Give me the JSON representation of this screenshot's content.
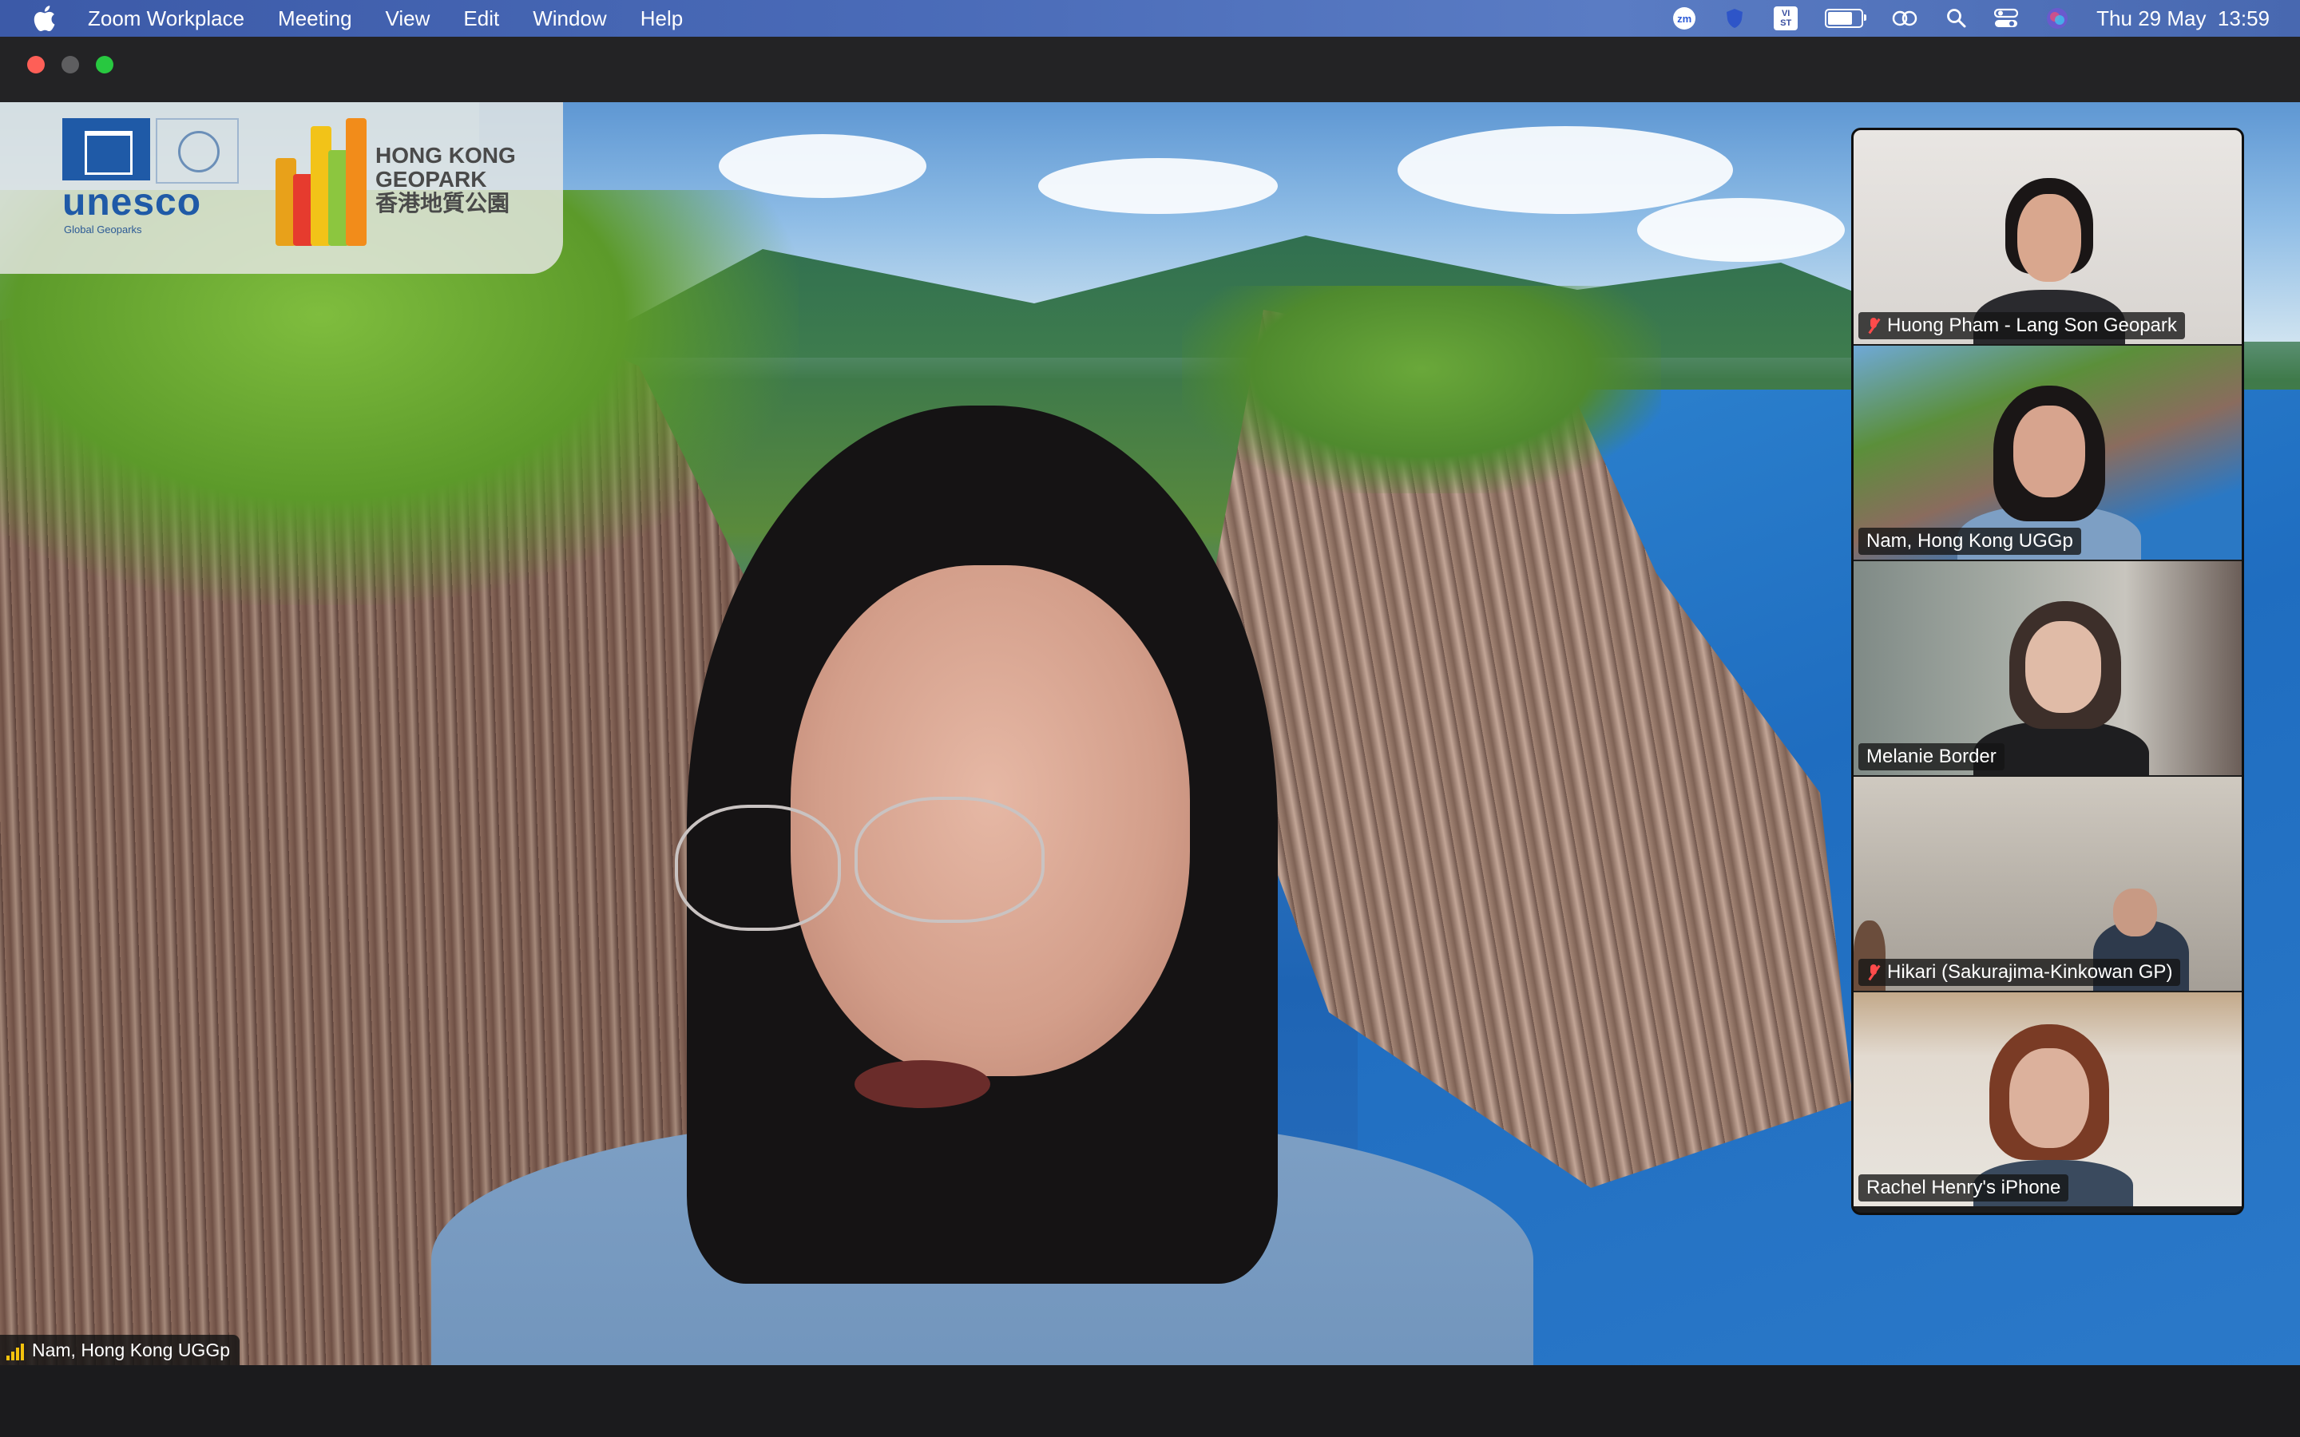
{
  "menubar": {
    "app_name": "Zoom Workplace",
    "items": [
      "Meeting",
      "View",
      "Edit",
      "Window",
      "Help"
    ],
    "status": {
      "zoom_badge": "zm",
      "vist_badge_top": "VI",
      "vist_badge_bottom": "ST",
      "date": "Thu 29 May",
      "time": "13:59",
      "battery_level": 0.75
    }
  },
  "main_video": {
    "speaker_label": "Nam, Hong Kong UGGp",
    "logos": {
      "unesco_text": "unesco",
      "unesco_sub": "Global Geoparks",
      "geopark_line1": "HONG KONG",
      "geopark_line2": "GEOPARK",
      "geopark_line3": "香港地質公園"
    }
  },
  "participants": [
    {
      "name": "Huong Pham - Lang Son Geopark",
      "muted": true,
      "active": false
    },
    {
      "name": "Nam, Hong Kong UGGp",
      "muted": false,
      "active": true
    },
    {
      "name": "Melanie Border",
      "muted": false,
      "active": false
    },
    {
      "name": "Hikari (Sakurajima-Kinkowan GP)",
      "muted": true,
      "active": false
    },
    {
      "name": "Rachel Henry's iPhone",
      "muted": false,
      "active": false
    }
  ],
  "colors": {
    "active_speaker": "#23d95a",
    "mic_muted": "#ff4b4b",
    "menubar": "#4a6bb8"
  }
}
